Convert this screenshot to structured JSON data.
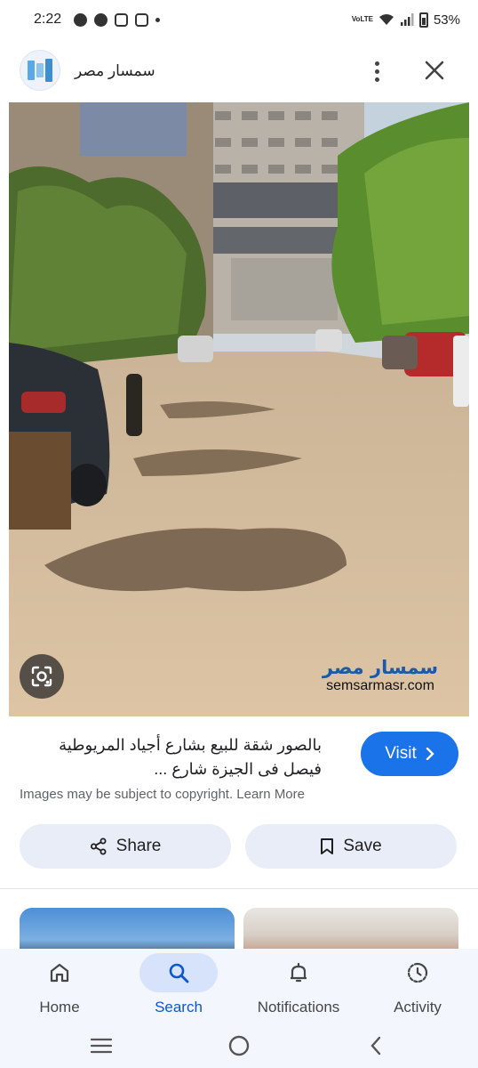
{
  "status_bar": {
    "time": "2:22",
    "notification_icons": [
      "messenger-icon",
      "messenger-icon",
      "instagram-icon",
      "instagram-icon"
    ],
    "network": "VoLTE",
    "battery": "53%"
  },
  "header": {
    "site_name": "سمسار مصر"
  },
  "image": {
    "watermark_ar": "سمسار مصر",
    "watermark_en": "semsarmasr.com"
  },
  "result": {
    "title_line1": "بالصور شقة للبيع بشارع أجياد المريوطية",
    "title_line2": "فيصل فى الجيزة شارع ...",
    "visit_label": "Visit",
    "copyright_text": "Images may be subject to copyright. Learn More"
  },
  "actions": {
    "share_label": "Share",
    "save_label": "Save"
  },
  "bottom_nav": {
    "items": [
      {
        "label": "Home",
        "icon": "home-icon",
        "active": false
      },
      {
        "label": "Search",
        "icon": "search-icon",
        "active": true
      },
      {
        "label": "Notifications",
        "icon": "bell-icon",
        "active": false
      },
      {
        "label": "Activity",
        "icon": "activity-icon",
        "active": false
      }
    ]
  },
  "colors": {
    "accent": "#1a73e8",
    "nav_active": "#0b57d0",
    "button_bg": "#e8edf8",
    "nav_bg": "#f3f6fc"
  }
}
